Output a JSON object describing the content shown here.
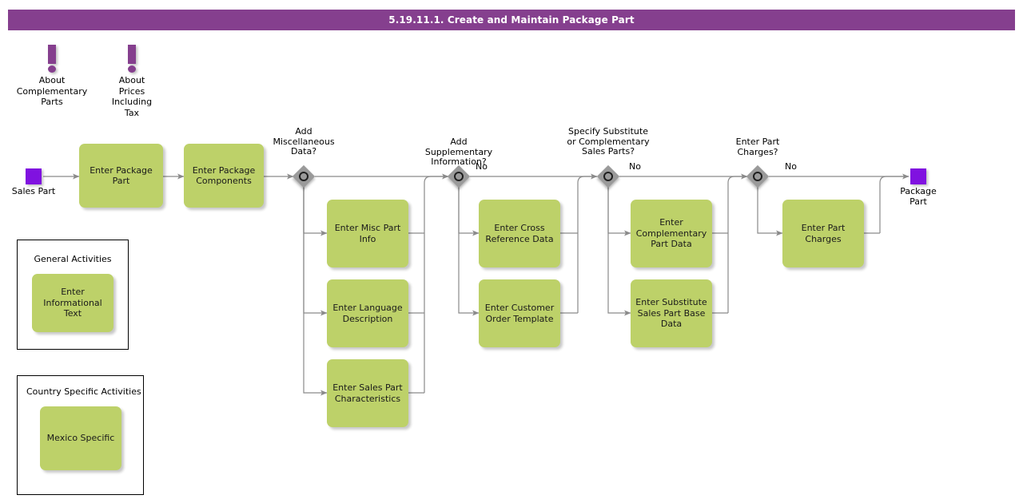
{
  "header": {
    "title": "5.19.11.1. Create and Maintain Package Part",
    "background_color": "#853f8e",
    "text_color": "#ffffff"
  },
  "theme": {
    "task_fill": "#bdd169",
    "gateway_fill": "#9a9a9a",
    "event_fill": "#8012e0",
    "annotation_color": "#853f8e",
    "connector_color": "#8a8a8a"
  },
  "annotations": [
    {
      "id": "about-complementary-parts",
      "icon": "exclamation-icon",
      "label": "About\nComplementary\nParts"
    },
    {
      "id": "about-prices-including-tax",
      "icon": "exclamation-icon",
      "label": "About\nPrices\nIncluding\nTax"
    }
  ],
  "events": [
    {
      "id": "start-sales-part",
      "type": "start",
      "label": "Sales Part"
    },
    {
      "id": "end-package-part",
      "type": "end",
      "label": "Package\nPart"
    }
  ],
  "tasks": [
    {
      "id": "enter-package-part",
      "label": "Enter Package\nPart"
    },
    {
      "id": "enter-package-components",
      "label": "Enter Package\nComponents"
    },
    {
      "id": "enter-misc-part-info",
      "label": "Enter Misc Part\nInfo"
    },
    {
      "id": "enter-language-description",
      "label": "Enter Language\nDescription"
    },
    {
      "id": "enter-sales-part-characteristics",
      "label": "Enter Sales Part\nCharacteristics"
    },
    {
      "id": "enter-cross-reference-data",
      "label": "Enter Cross\nReference Data"
    },
    {
      "id": "enter-customer-order-template",
      "label": "Enter Customer\nOrder Template"
    },
    {
      "id": "enter-complementary-part-data",
      "label": "Enter\nComplementary\nPart Data"
    },
    {
      "id": "enter-substitute-sales-part-base-data",
      "label": "Enter Substitute\nSales Part Base\nData"
    },
    {
      "id": "enter-part-charges",
      "label": "Enter Part\nCharges"
    }
  ],
  "gateways": [
    {
      "id": "add-miscellaneous-data",
      "label": "Add\nMiscellaneous\nData?",
      "flow_label": ""
    },
    {
      "id": "add-supplementary-information",
      "label": "Add\nSupplementary\nInformation?",
      "flow_label": "No"
    },
    {
      "id": "specify-substitute-or-complementary-sales-parts",
      "label": "Specify Substitute\nor Complementary\nSales Parts?",
      "flow_label": "No"
    },
    {
      "id": "enter-part-charges-question",
      "label": "Enter Part\nCharges?",
      "flow_label": "No"
    }
  ],
  "legends": [
    {
      "id": "general-activities",
      "title": "General Activities",
      "task": {
        "id": "enter-informational-text",
        "label": "Enter\nInformational\nText"
      }
    },
    {
      "id": "country-specific-activities",
      "title": "Country Specific Activities",
      "task": {
        "id": "mexico-specific",
        "label": "Mexico Specific"
      }
    }
  ]
}
